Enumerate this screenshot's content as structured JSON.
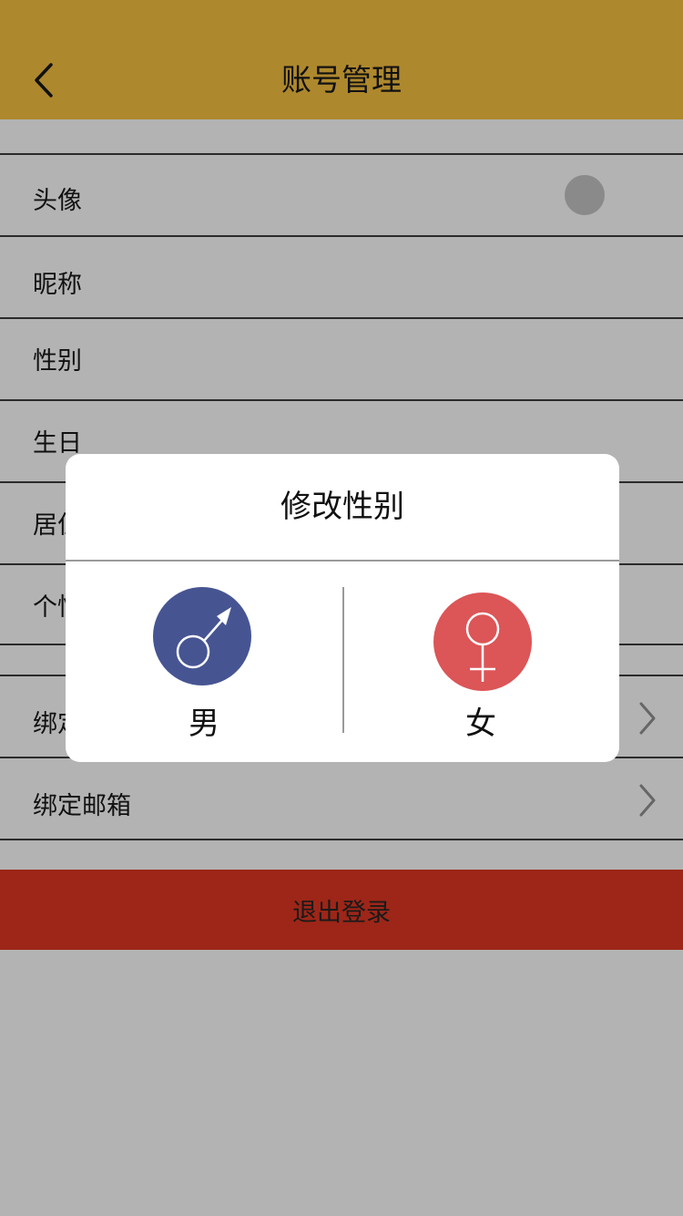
{
  "header": {
    "title": "账号管理",
    "back_icon": "chevron-left-icon",
    "color": "#ae882d"
  },
  "rows": [
    {
      "label": "头像"
    },
    {
      "label": "昵称"
    },
    {
      "label": "性别"
    },
    {
      "label": "生日"
    },
    {
      "label": "居住地"
    },
    {
      "label": "个性签名"
    },
    {
      "label": "绑定手机"
    },
    {
      "label": "绑定邮箱"
    }
  ],
  "logout": {
    "label": "退出登录",
    "color": "#9d2618"
  },
  "modal": {
    "title": "修改性别",
    "options": [
      {
        "label": "男",
        "icon": "male-symbol-icon",
        "color": "#465592"
      },
      {
        "label": "女",
        "icon": "female-symbol-icon",
        "color": "#dc5557"
      }
    ]
  },
  "colors": {
    "background": "#b3b3b3",
    "avatar_placeholder": "#8a8a8a"
  }
}
